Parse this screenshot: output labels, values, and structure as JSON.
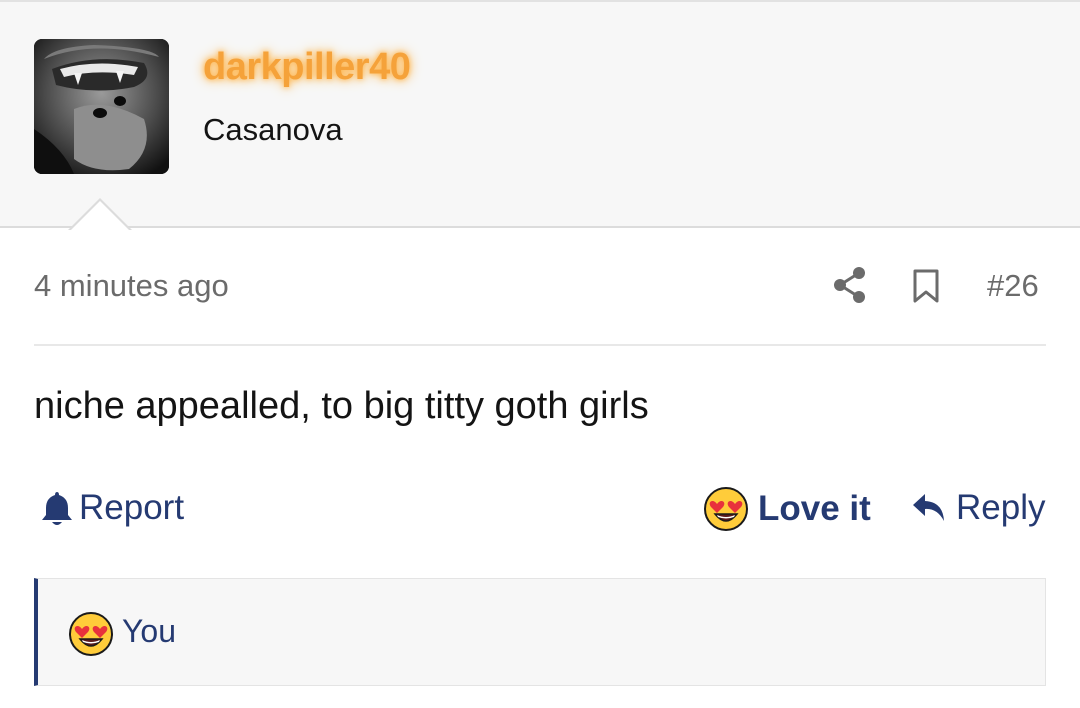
{
  "post": {
    "username": "darkpiller40",
    "user_title": "Casanova",
    "timestamp": "4 minutes ago",
    "post_number": "#26",
    "content": "niche appealled, to big titty goth girls"
  },
  "actions": {
    "report_label": "Report",
    "love_label": "Love it",
    "reply_label": "Reply"
  },
  "reactions": {
    "reactor": "You",
    "emoji": "heart-eyes-emoji"
  },
  "colors": {
    "username": "#f5a23a",
    "link": "#253a72",
    "muted": "#6b6b6b",
    "header_bg": "#f7f7f7"
  },
  "icons": [
    "share-icon",
    "bookmark-icon",
    "bell-icon",
    "heart-eyes-emoji",
    "reply-arrow-icon"
  ]
}
